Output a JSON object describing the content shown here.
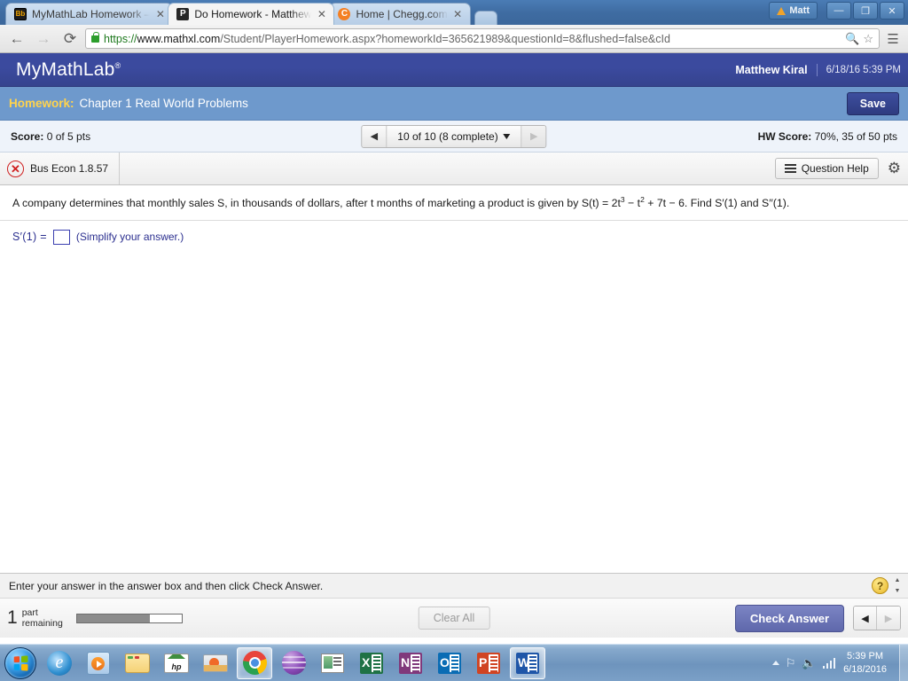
{
  "browser": {
    "tabs": [
      {
        "favicon": "blackboard-icon",
        "title": "MyMathLab Homework –",
        "active": false
      },
      {
        "favicon": "pearson-icon",
        "title": "Do Homework - Matthew",
        "active": true
      },
      {
        "favicon": "chegg-icon",
        "title": "Home | Chegg.com",
        "active": false
      }
    ],
    "new_tab_label": "",
    "close_label": "✕",
    "user_button": "Matt",
    "window_controls": {
      "minimize": "—",
      "maximize": "❐",
      "close": "✕"
    },
    "nav": {
      "back": "←",
      "forward": "→",
      "reload": "⟳"
    },
    "omnibox": {
      "scheme": "https://",
      "host": "www.mathxl.com",
      "path": "/Student/PlayerHomework.aspx?homeworkId=365621989&questionId=8&flushed=false&cId",
      "zoom_icon": "magnifier-icon",
      "star_icon": "star-icon",
      "menu_icon": "hamburger-menu-icon"
    }
  },
  "mml_header": {
    "logo": "MyMathLab",
    "logo_sup": "®",
    "user": "Matthew Kiral",
    "datetime": "6/18/16 5:39 PM"
  },
  "homework_bar": {
    "label": "Homework:",
    "name": "Chapter 1 Real World Problems",
    "save_label": "Save"
  },
  "score_bar": {
    "score_label": "Score:",
    "score_value": "0 of 5 pts",
    "hw_score_label": "HW Score:",
    "hw_score_value": "70%, 35 of 50 pts",
    "pager": {
      "prev": "◀",
      "next": "▶",
      "text": "10 of 10 (8 complete)"
    }
  },
  "question_toolbar": {
    "status_icon": "x-circle-icon",
    "question_id": "Bus Econ 1.8.57",
    "question_help": "Question Help",
    "gear_icon": "gear-icon"
  },
  "question": {
    "stem_part1": "A company determines that monthly sales S, in thousands of dollars, after t months of marketing a product is given by S(t) = 2t",
    "stem_exp1": "3",
    "stem_part2": " − t",
    "stem_exp2": "2",
    "stem_part3": " + 7t − 6. Find S′(1) and S′′(1).",
    "answer_label": "S′(1) =",
    "answer_value": "",
    "answer_hint": "(Simplify your answer.)"
  },
  "footer": {
    "instruction": "Enter your answer in the answer box and then click Check Answer.",
    "help_icon": "question-mark-help-icon",
    "scroll_up": "▲",
    "scroll_down": "▼",
    "parts_count": "1",
    "parts_label_line1": "part",
    "parts_label_line2": "remaining",
    "progress_percent": 70,
    "clear_all": "Clear All",
    "check_answer": "Check Answer",
    "prev_arrow": "◀",
    "next_arrow": "▶"
  },
  "taskbar": {
    "start_icon": "windows-start-orb-icon",
    "items": [
      {
        "icon": "internet-explorer-icon",
        "running": false
      },
      {
        "icon": "windows-media-player-icon",
        "running": false
      },
      {
        "icon": "file-explorer-icon",
        "running": false
      },
      {
        "icon": "hp-support-icon",
        "running": false
      },
      {
        "icon": "photo-viewer-icon",
        "running": false
      },
      {
        "icon": "google-chrome-icon",
        "running": true
      },
      {
        "icon": "purple-globe-icon",
        "running": false
      },
      {
        "icon": "window-app-icon",
        "running": false
      },
      {
        "icon": "microsoft-excel-icon",
        "running": false,
        "letter": "X"
      },
      {
        "icon": "microsoft-onenote-icon",
        "running": false,
        "letter": "N"
      },
      {
        "icon": "microsoft-outlook-icon",
        "running": false,
        "letter": "O"
      },
      {
        "icon": "microsoft-powerpoint-icon",
        "running": false,
        "letter": "P"
      },
      {
        "icon": "microsoft-word-icon",
        "running": true,
        "letter": "W"
      }
    ],
    "tray": {
      "show_hidden_icon": "tray-arrow-icon",
      "action_center_icon": "flag-icon",
      "volume_icon": "speaker-icon",
      "network_icon": "signal-bars-icon",
      "time": "5:39 PM",
      "date": "6/18/2016"
    }
  }
}
